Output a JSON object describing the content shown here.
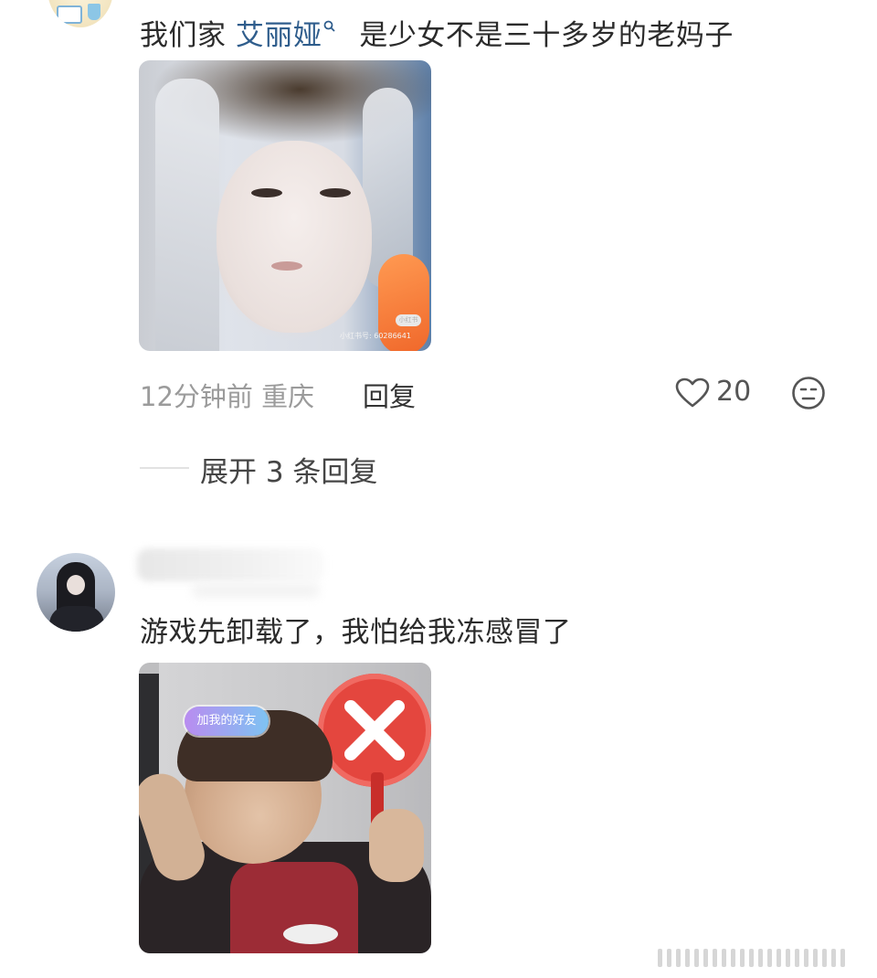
{
  "comment1": {
    "text_before": "我们家",
    "mention": "艾丽娅",
    "text_after": "是少女不是三十多岁的老妈子",
    "time": "12分钟前",
    "location": "重庆",
    "reply_label": "回复",
    "likes": "20",
    "expand_replies": "展开 3 条回复",
    "image_watermark_badge": "小红书",
    "image_watermark_text": "小红书号: 60286641"
  },
  "comment2": {
    "text": "游戏先卸载了，我怕给我冻感冒了",
    "image_badge": "加我的好友"
  },
  "icons": {
    "mention_search": "search-icon",
    "like": "heart-icon",
    "emoji": "emoji-face-icon"
  },
  "colors": {
    "mention": "#2f5d8c",
    "meta": "#9b9b9b",
    "text": "#2b2b2b"
  }
}
